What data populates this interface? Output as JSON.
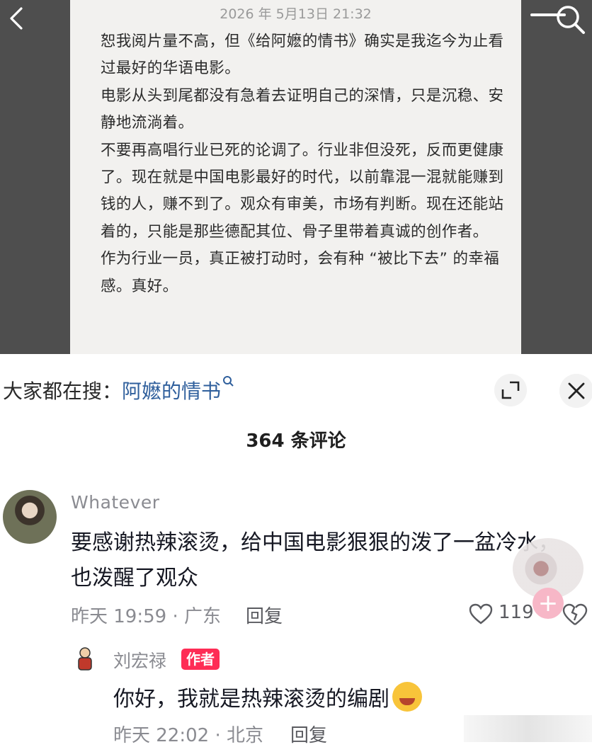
{
  "note": {
    "timestamp": "2026 年 5月13日 21:32",
    "paragraphs": [
      "恕我阅片量不高，但《给阿嬷的情书》确实是我迄今为止看过最好的华语电影。",
      "电影从头到尾都没有急着去证明自己的深情，只是沉稳、安静地流淌着。",
      "不要再高唱行业已死的论调了。行业非但没死，反而更健康了。现在就是中国电影最好的时代，以前靠混一混就能赚到钱的人，赚不到了。观众有审美，市场有判断。现在还能站着的，只能是那些德配其位、骨子里带着真诚的创作者。",
      "作为行业一员，真正被打动时，会有种 “被比下去” 的幸福感。真好。"
    ]
  },
  "search_suggestion": {
    "prefix": "大家都在搜：",
    "keyword": "阿嬷的情书"
  },
  "comments_header": "364 条评论",
  "comment": {
    "user": "Whatever",
    "text": "要感谢热辣滚烫，给中国电影狠狠的泼了一盆冷水，也泼醒了观众",
    "meta": "昨天 19:59 · 广东",
    "reply_label": "回复",
    "likes": "119"
  },
  "reply": {
    "user": "刘宏禄",
    "badge": "作者",
    "text": "你好，我就是热辣滚烫的编剧",
    "meta": "昨天 22:02 · 北京",
    "reply_label": "回复"
  },
  "colors": {
    "accent": "#fe2c55",
    "link": "#2f5f9c"
  }
}
